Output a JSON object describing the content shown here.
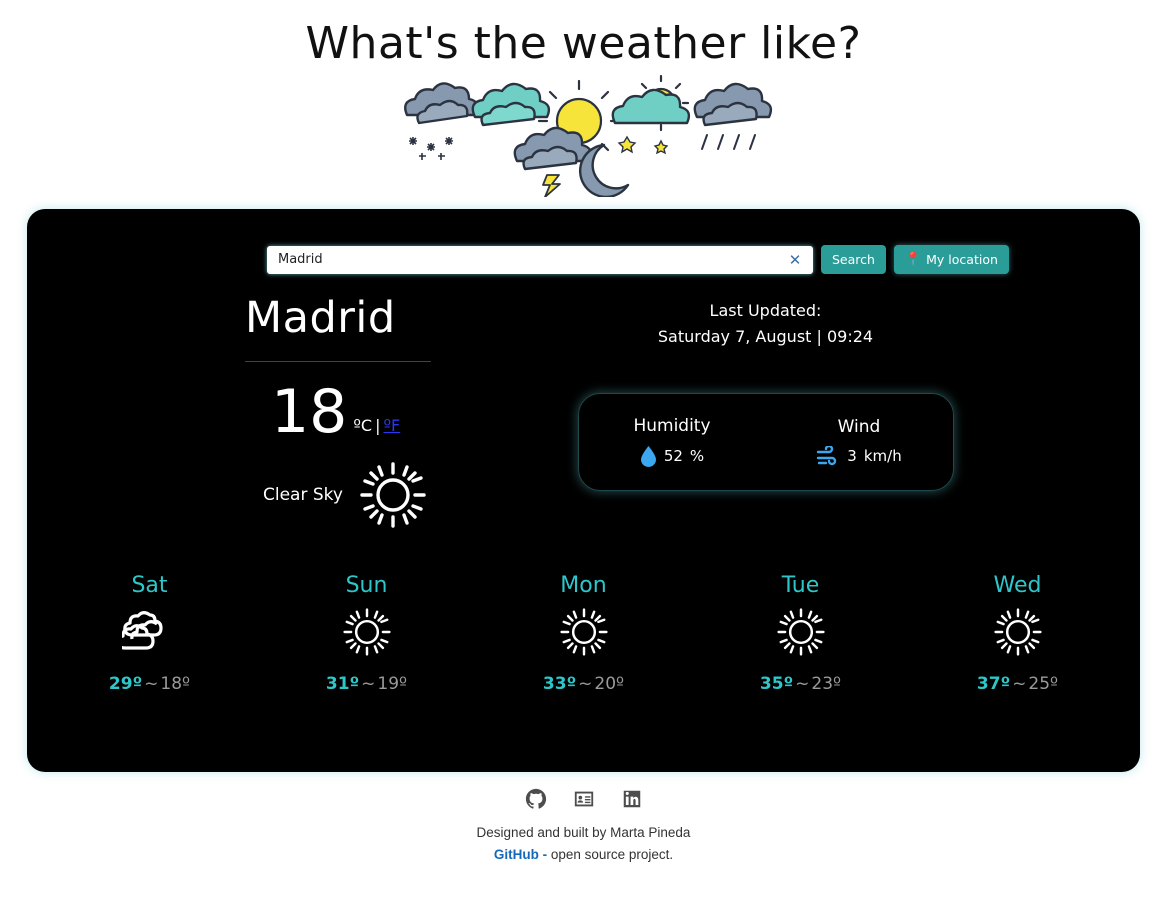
{
  "header": {
    "title": "What's the weather like?",
    "illustration_name": "hand-drawn-weather-icons-banner"
  },
  "search": {
    "value": "Madrid",
    "placeholder": "Madrid",
    "clear_icon": "close-x-icon",
    "search_label": "Search",
    "location_label": "My location",
    "location_icon": "map-pin-icon"
  },
  "current": {
    "city": "Madrid",
    "temperature": "18",
    "unit_active": "ºC",
    "unit_separator": "|",
    "unit_link": "ºF",
    "condition": "Clear Sky",
    "condition_icon": "sun-icon",
    "updated_label": "Last Updated:",
    "updated_value": "Saturday 7, August | 09:24"
  },
  "details": {
    "humidity": {
      "title": "Humidity",
      "icon": "water-drop-icon",
      "value": "52",
      "unit": "%"
    },
    "wind": {
      "title": "Wind",
      "icon": "wind-icon",
      "value": "3",
      "unit": "km/h"
    }
  },
  "forecast": [
    {
      "day": "Sat",
      "icon": "clouds-icon",
      "high": "29º",
      "tilde": "~",
      "low": "18º"
    },
    {
      "day": "Sun",
      "icon": "sun-icon",
      "high": "31º",
      "tilde": "~",
      "low": "19º"
    },
    {
      "day": "Mon",
      "icon": "sun-icon",
      "high": "33º",
      "tilde": "~",
      "low": "20º"
    },
    {
      "day": "Tue",
      "icon": "sun-icon",
      "high": "35º",
      "tilde": "~",
      "low": "23º"
    },
    {
      "day": "Wed",
      "icon": "sun-icon",
      "high": "37º",
      "tilde": "~",
      "low": "25º"
    }
  ],
  "footer": {
    "social": [
      {
        "name": "github-icon"
      },
      {
        "name": "portfolio-card-icon"
      },
      {
        "name": "linkedin-icon"
      }
    ],
    "credit": "Designed and built by Marta Pineda",
    "link_text": "GitHub -",
    "link_suffix": " open source project."
  },
  "colors": {
    "accent_teal": "#2ec7c9",
    "button_teal": "#2a9d98",
    "card_bg": "#000000",
    "page_bg": "#ffffff",
    "link_blue": "#2b37f0",
    "muted_gray": "#9a9a9a"
  }
}
